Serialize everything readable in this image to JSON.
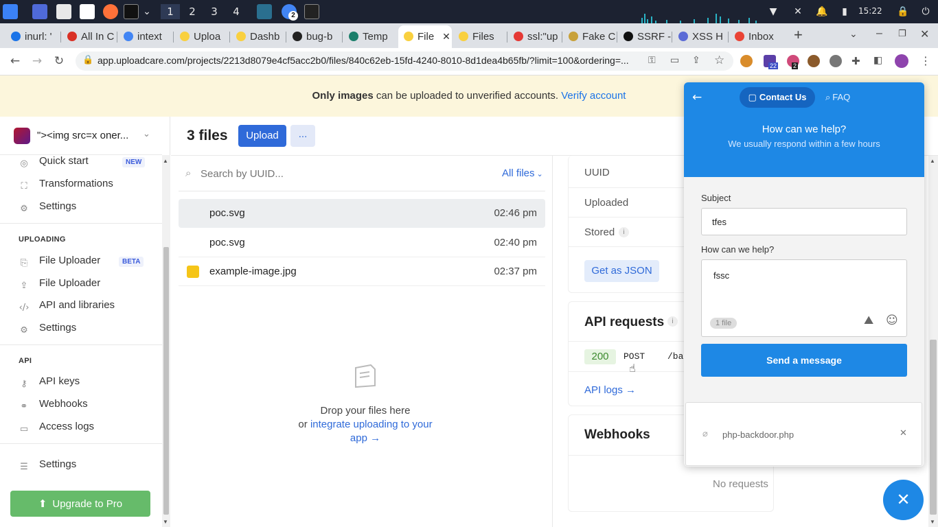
{
  "taskbar": {
    "workspaces": [
      "1",
      "2",
      "3",
      "4"
    ],
    "clock": "15:22",
    "chrome_badge": "2"
  },
  "browser": {
    "tabs": [
      {
        "label": "inurl: '",
        "fav": "#1a73e8"
      },
      {
        "label": "All In C",
        "fav": "#d93025"
      },
      {
        "label": "intext",
        "fav": "#4285f4"
      },
      {
        "label": "Uploa",
        "fav": "#f9d03f"
      },
      {
        "label": "Dashb",
        "fav": "#f9d03f"
      },
      {
        "label": "bug-b",
        "fav": "#222"
      },
      {
        "label": "Temp",
        "fav": "#1b7f6b"
      },
      {
        "label": "File",
        "fav": "#f9d03f"
      },
      {
        "label": "Files",
        "fav": "#f9d03f"
      },
      {
        "label": "ssl:\"up",
        "fav": "#e53935"
      },
      {
        "label": "Fake C",
        "fav": "#c8a13a"
      },
      {
        "label": "SSRF -",
        "fav": "#111"
      },
      {
        "label": "XSS H",
        "fav": "#5b6bd6"
      },
      {
        "label": "Inbox",
        "fav": "#ea4335"
      }
    ],
    "new_tab": "+",
    "url": "app.uploadcare.com/projects/2213d8079e4cf5acc2b0/files/840c62eb-15fd-4240-8010-8d1dea4b65fb/?limit=100&ordering=...",
    "ext_badges": [
      "22",
      "2"
    ]
  },
  "banner": {
    "bold": "Only images",
    "text": " can be uploaded to unverified accounts. ",
    "link": "Verify account"
  },
  "sidebar": {
    "project_name": "\"><img src=x oner...",
    "items_top": [
      {
        "label": "Quick start",
        "badge": "NEW",
        "icon": "rocket-icon"
      },
      {
        "label": "Transformations",
        "icon": "crop-icon"
      },
      {
        "label": "Settings",
        "icon": "gear-icon"
      }
    ],
    "uploading_title": "UPLOADING",
    "items_uploading": [
      {
        "label": "File Uploader",
        "badge": "BETA",
        "icon": "uploader-icon"
      },
      {
        "label": "File Uploader",
        "icon": "upload-icon"
      },
      {
        "label": "API and libraries",
        "icon": "code-icon"
      },
      {
        "label": "Settings",
        "icon": "gear-icon"
      }
    ],
    "api_title": "API",
    "items_api": [
      {
        "label": "API keys",
        "icon": "key-icon"
      },
      {
        "label": "Webhooks",
        "icon": "webhook-icon"
      },
      {
        "label": "Access logs",
        "icon": "terminal-icon"
      }
    ],
    "settings": "Settings",
    "upgrade": "Upgrade to Pro"
  },
  "header": {
    "title": "3 files",
    "upload_button": "Upload",
    "more_button": "..."
  },
  "files": {
    "search_placeholder": "Search by UUID...",
    "filter": "All files",
    "rows": [
      {
        "name": "poc.svg",
        "time": "02:46 pm"
      },
      {
        "name": "poc.svg",
        "time": "02:40 pm"
      },
      {
        "name": "example-image.jpg",
        "time": "02:37 pm"
      }
    ],
    "drop_line1": "Drop your files here",
    "drop_or": "or ",
    "drop_link": "integrate uploading to your app →"
  },
  "details": {
    "uuid_label": "UUID",
    "uploaded_label": "Uploaded",
    "stored_label": "Stored",
    "json_button": "Get as JSON",
    "api_requests_title": "API requests",
    "request_status": "200",
    "request_method": "POST",
    "request_path": "/ba",
    "api_logs_link": "API logs →",
    "webhooks_title": "Webhooks",
    "no_requests": "No requests"
  },
  "chat": {
    "tab_contact": "Contact Us",
    "tab_faq": "FAQ",
    "title": "How can we help?",
    "subtitle": "We usually respond within a few hours",
    "subject_label": "Subject",
    "subject_value": "tfes",
    "message_label": "How can we help?",
    "message_value": "fssc",
    "file_badge": "1 file",
    "send_button": "Send a message",
    "attachment_name": "php-backdoor.php"
  }
}
